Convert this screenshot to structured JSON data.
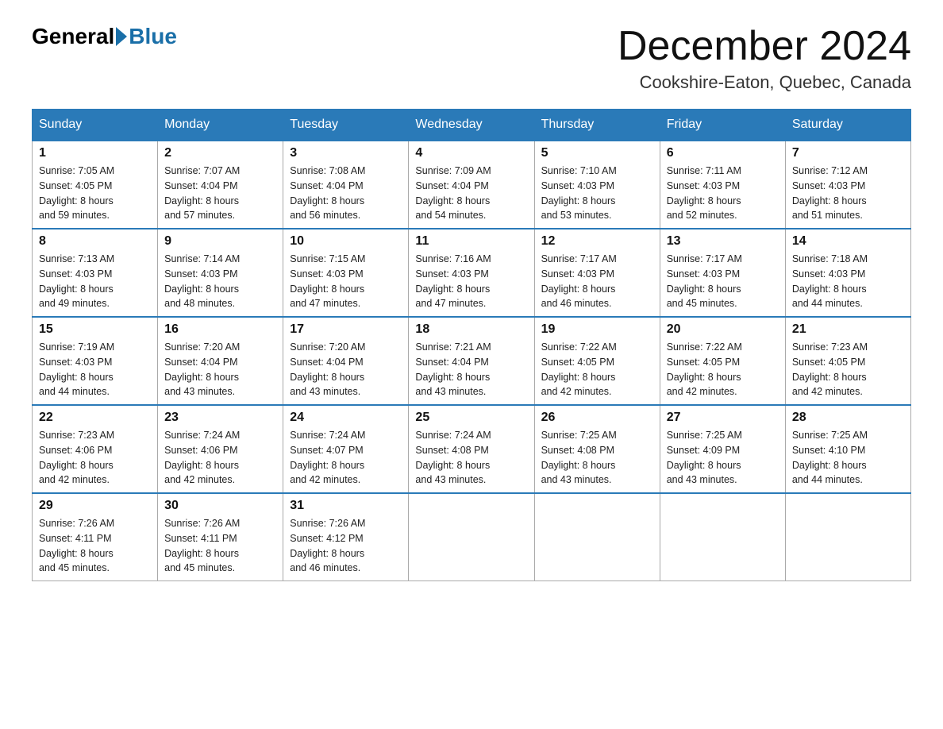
{
  "header": {
    "logo_general": "General",
    "logo_blue": "Blue",
    "month_title": "December 2024",
    "subtitle": "Cookshire-Eaton, Quebec, Canada"
  },
  "weekdays": [
    "Sunday",
    "Monday",
    "Tuesday",
    "Wednesday",
    "Thursday",
    "Friday",
    "Saturday"
  ],
  "weeks": [
    [
      {
        "day": "1",
        "sunrise": "7:05 AM",
        "sunset": "4:05 PM",
        "daylight": "8 hours and 59 minutes."
      },
      {
        "day": "2",
        "sunrise": "7:07 AM",
        "sunset": "4:04 PM",
        "daylight": "8 hours and 57 minutes."
      },
      {
        "day": "3",
        "sunrise": "7:08 AM",
        "sunset": "4:04 PM",
        "daylight": "8 hours and 56 minutes."
      },
      {
        "day": "4",
        "sunrise": "7:09 AM",
        "sunset": "4:04 PM",
        "daylight": "8 hours and 54 minutes."
      },
      {
        "day": "5",
        "sunrise": "7:10 AM",
        "sunset": "4:03 PM",
        "daylight": "8 hours and 53 minutes."
      },
      {
        "day": "6",
        "sunrise": "7:11 AM",
        "sunset": "4:03 PM",
        "daylight": "8 hours and 52 minutes."
      },
      {
        "day": "7",
        "sunrise": "7:12 AM",
        "sunset": "4:03 PM",
        "daylight": "8 hours and 51 minutes."
      }
    ],
    [
      {
        "day": "8",
        "sunrise": "7:13 AM",
        "sunset": "4:03 PM",
        "daylight": "8 hours and 49 minutes."
      },
      {
        "day": "9",
        "sunrise": "7:14 AM",
        "sunset": "4:03 PM",
        "daylight": "8 hours and 48 minutes."
      },
      {
        "day": "10",
        "sunrise": "7:15 AM",
        "sunset": "4:03 PM",
        "daylight": "8 hours and 47 minutes."
      },
      {
        "day": "11",
        "sunrise": "7:16 AM",
        "sunset": "4:03 PM",
        "daylight": "8 hours and 47 minutes."
      },
      {
        "day": "12",
        "sunrise": "7:17 AM",
        "sunset": "4:03 PM",
        "daylight": "8 hours and 46 minutes."
      },
      {
        "day": "13",
        "sunrise": "7:17 AM",
        "sunset": "4:03 PM",
        "daylight": "8 hours and 45 minutes."
      },
      {
        "day": "14",
        "sunrise": "7:18 AM",
        "sunset": "4:03 PM",
        "daylight": "8 hours and 44 minutes."
      }
    ],
    [
      {
        "day": "15",
        "sunrise": "7:19 AM",
        "sunset": "4:03 PM",
        "daylight": "8 hours and 44 minutes."
      },
      {
        "day": "16",
        "sunrise": "7:20 AM",
        "sunset": "4:04 PM",
        "daylight": "8 hours and 43 minutes."
      },
      {
        "day": "17",
        "sunrise": "7:20 AM",
        "sunset": "4:04 PM",
        "daylight": "8 hours and 43 minutes."
      },
      {
        "day": "18",
        "sunrise": "7:21 AM",
        "sunset": "4:04 PM",
        "daylight": "8 hours and 43 minutes."
      },
      {
        "day": "19",
        "sunrise": "7:22 AM",
        "sunset": "4:05 PM",
        "daylight": "8 hours and 42 minutes."
      },
      {
        "day": "20",
        "sunrise": "7:22 AM",
        "sunset": "4:05 PM",
        "daylight": "8 hours and 42 minutes."
      },
      {
        "day": "21",
        "sunrise": "7:23 AM",
        "sunset": "4:05 PM",
        "daylight": "8 hours and 42 minutes."
      }
    ],
    [
      {
        "day": "22",
        "sunrise": "7:23 AM",
        "sunset": "4:06 PM",
        "daylight": "8 hours and 42 minutes."
      },
      {
        "day": "23",
        "sunrise": "7:24 AM",
        "sunset": "4:06 PM",
        "daylight": "8 hours and 42 minutes."
      },
      {
        "day": "24",
        "sunrise": "7:24 AM",
        "sunset": "4:07 PM",
        "daylight": "8 hours and 42 minutes."
      },
      {
        "day": "25",
        "sunrise": "7:24 AM",
        "sunset": "4:08 PM",
        "daylight": "8 hours and 43 minutes."
      },
      {
        "day": "26",
        "sunrise": "7:25 AM",
        "sunset": "4:08 PM",
        "daylight": "8 hours and 43 minutes."
      },
      {
        "day": "27",
        "sunrise": "7:25 AM",
        "sunset": "4:09 PM",
        "daylight": "8 hours and 43 minutes."
      },
      {
        "day": "28",
        "sunrise": "7:25 AM",
        "sunset": "4:10 PM",
        "daylight": "8 hours and 44 minutes."
      }
    ],
    [
      {
        "day": "29",
        "sunrise": "7:26 AM",
        "sunset": "4:11 PM",
        "daylight": "8 hours and 45 minutes."
      },
      {
        "day": "30",
        "sunrise": "7:26 AM",
        "sunset": "4:11 PM",
        "daylight": "8 hours and 45 minutes."
      },
      {
        "day": "31",
        "sunrise": "7:26 AM",
        "sunset": "4:12 PM",
        "daylight": "8 hours and 46 minutes."
      },
      null,
      null,
      null,
      null
    ]
  ],
  "labels": {
    "sunrise": "Sunrise:",
    "sunset": "Sunset:",
    "daylight": "Daylight:"
  }
}
